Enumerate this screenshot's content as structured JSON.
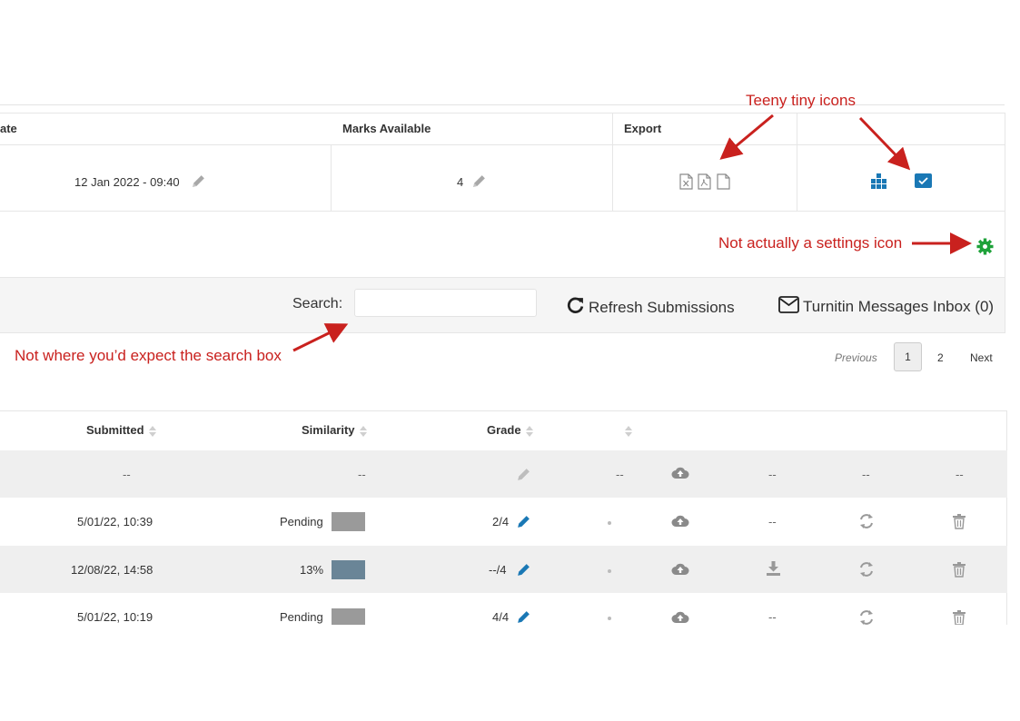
{
  "annotations": {
    "tiny_icons": "Teeny tiny icons",
    "settings_icon": "Not actually a settings icon",
    "search_box": "Not where you’d expect the search box"
  },
  "assignment_table": {
    "headers": {
      "date": "ate",
      "marks": "Marks Available",
      "export": "Export"
    },
    "date_value": "12 Jan 2022 - 09:40",
    "marks_value": "4"
  },
  "toolbar": {
    "search_label": "Search:",
    "search_value": "",
    "refresh_label": "Refresh Submissions",
    "inbox_label": "Turnitin Messages Inbox (0)"
  },
  "pagination": {
    "previous": "Previous",
    "current": "1",
    "page2": "2",
    "next": "Next"
  },
  "submissions": {
    "headers": {
      "submitted": "Submitted",
      "similarity": "Similarity",
      "grade": "Grade"
    },
    "placeholder_row": {
      "submitted": "--",
      "similarity": "--",
      "col5": "--",
      "col7": "--",
      "col8": "--",
      "col9": "--"
    },
    "rows": [
      {
        "submitted": "5/01/22, 10:39",
        "similarity": "Pending",
        "grade": "2/4",
        "col7": "--",
        "bar_color": "#9a9a9a"
      },
      {
        "submitted": "12/08/22, 14:58",
        "similarity": "13%",
        "grade": "--/4",
        "bar_color": "#6a8597"
      },
      {
        "submitted": "5/01/22, 10:19",
        "similarity": "Pending",
        "grade": "4/4",
        "col7": "--",
        "bar_color": "#9a9a9a"
      }
    ]
  },
  "colors": {
    "annotation": "#c9211e",
    "accent_blue": "#1a78b5",
    "green": "#1fa23a"
  }
}
